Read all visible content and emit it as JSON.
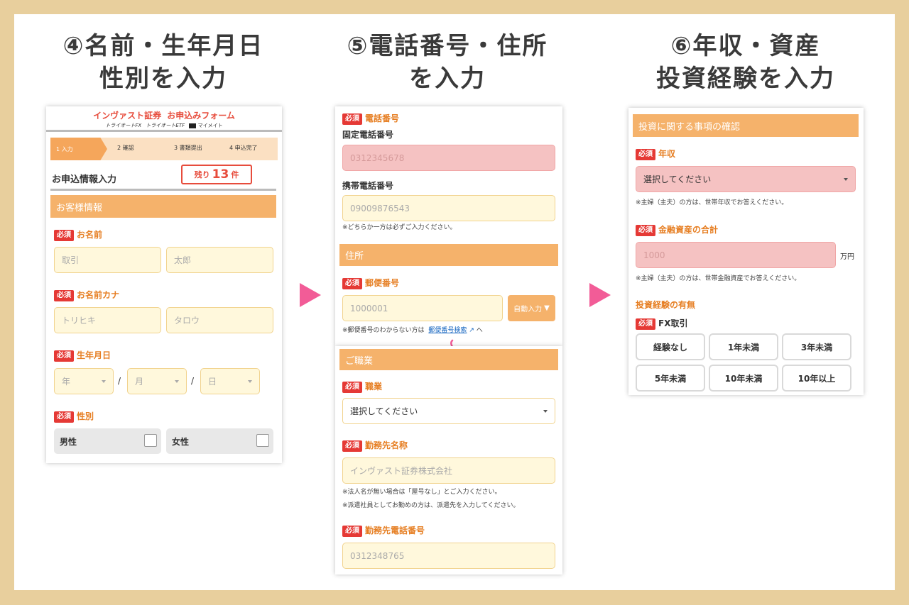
{
  "steps": [
    {
      "line1": "④名前・生年月日",
      "line2": "性別を入力"
    },
    {
      "line1": "⑤電話番号・住所",
      "line2": "を入力"
    },
    {
      "line1": "⑥年収・資産",
      "line2": "投資経験を入力"
    }
  ],
  "panel1": {
    "brand": "インヴァスト証券",
    "form_title": "お申込みフォーム",
    "sub_brands": [
      "トライオートFX",
      "トライオートETF",
      "マイメイト"
    ],
    "progress": [
      "1 入力",
      "2 確認",
      "3 書類提出",
      "4 申込完了"
    ],
    "page_heading": "お申込情報入力",
    "remaining_prefix": "残り",
    "remaining_count": "13",
    "remaining_suffix": "件",
    "section": "お客様情報",
    "required": "必須",
    "name_label": "お名前",
    "name_last_placeholder": "取引",
    "name_first_placeholder": "太郎",
    "kana_label": "お名前カナ",
    "kana_last_placeholder": "トリヒキ",
    "kana_first_placeholder": "タロウ",
    "birth_label": "生年月日",
    "year": "年",
    "month": "月",
    "day": "日",
    "slash": "/",
    "gender_label": "性別",
    "male": "男性",
    "female": "女性"
  },
  "panel2": {
    "required": "必須",
    "phone_label": "電話番号",
    "landline_label": "固定電話番号",
    "landline_placeholder": "0312345678",
    "mobile_label": "携帯電話番号",
    "mobile_placeholder": "09009876543",
    "phone_note": "※どちらか一方は必ずご入力ください。",
    "address_section": "住所",
    "postal_label": "郵便番号",
    "postal_placeholder": "1000001",
    "auto_fill": "自動入力",
    "postal_note_prefix": "※郵便番号のわからない方は",
    "postal_link": "郵便番号検索",
    "postal_note_suffix": "へ",
    "job_section": "ご職業",
    "job_label": "職業",
    "job_select": "選択してください",
    "employer_label": "勤務先名称",
    "employer_placeholder": "インヴァスト証券株式会社",
    "employer_note1": "※法人名が無い場合は「屋号なし」とご入力ください。",
    "employer_note2": "※派遣社員としてお勤めの方は、派遣先を入力してください。",
    "employer_phone_label": "勤務先電話番号",
    "employer_phone_placeholder": "0312348765"
  },
  "panel3": {
    "section": "投資に関する事項の確認",
    "required": "必須",
    "income_label": "年収",
    "income_select": "選択してください",
    "income_note": "※主婦（主夫）の方は、世帯年収でお答えください。",
    "assets_label": "金融資産の合計",
    "assets_placeholder": "1000",
    "assets_unit": "万円",
    "assets_note": "※主婦（主夫）の方は、世帯金融資産でお答えください。",
    "experience_heading": "投資経験の有無",
    "fx_label": "FX取引",
    "options": [
      "経験なし",
      "1年未満",
      "3年未満",
      "5年未満",
      "10年未満",
      "10年以上"
    ]
  },
  "colors": {
    "accent_orange": "#f5b26b",
    "required_red": "#e53935",
    "arrow_pink": "#f25c97",
    "frame_beige": "#e8cf9d"
  }
}
